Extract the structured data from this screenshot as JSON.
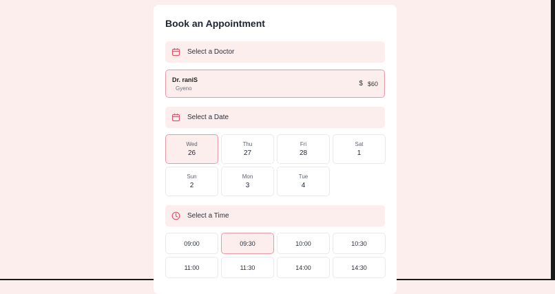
{
  "page": {
    "title": "Book an Appointment"
  },
  "doctor_section": {
    "label": "Select a Doctor",
    "icon": "calendar-icon"
  },
  "doctor": {
    "name": "Dr. raniS",
    "specialty": "Gyeno",
    "currency_symbol": "$",
    "price": "$60"
  },
  "date_section": {
    "label": "Select a Date",
    "icon": "calendar-icon"
  },
  "dates": [
    {
      "dow": "Wed",
      "day": "26",
      "selected": true
    },
    {
      "dow": "Thu",
      "day": "27",
      "selected": false
    },
    {
      "dow": "Fri",
      "day": "28",
      "selected": false
    },
    {
      "dow": "Sat",
      "day": "1",
      "selected": false
    },
    {
      "dow": "Sun",
      "day": "2",
      "selected": false
    },
    {
      "dow": "Mon",
      "day": "3",
      "selected": false
    },
    {
      "dow": "Tue",
      "day": "4",
      "selected": false
    }
  ],
  "time_section": {
    "label": "Select a Time",
    "icon": "clock-icon"
  },
  "times": [
    {
      "label": "09:00",
      "selected": false
    },
    {
      "label": "09:30",
      "selected": true
    },
    {
      "label": "10:00",
      "selected": false
    },
    {
      "label": "10:30",
      "selected": false
    },
    {
      "label": "11:00",
      "selected": false
    },
    {
      "label": "11:30",
      "selected": false
    },
    {
      "label": "14:00",
      "selected": false
    },
    {
      "label": "14:30",
      "selected": false
    }
  ],
  "colors": {
    "accent": "#e0556b",
    "selected_bg": "#fdeeee",
    "selected_border": "#e79aa6"
  }
}
